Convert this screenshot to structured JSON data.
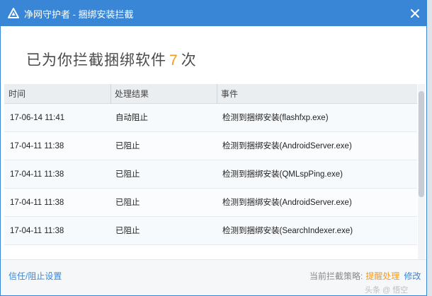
{
  "window": {
    "title": "净网守护者 - 捆绑安装拦截",
    "logo_icon": "triangle-shield-icon",
    "close_icon": "close-icon",
    "accent_color": "#3a86d6"
  },
  "heading": {
    "prefix": "已为你拦截捆绑软件",
    "count": "7",
    "suffix": "次",
    "count_color": "#f39a1e"
  },
  "table": {
    "columns": [
      "时间",
      "处理结果",
      "事件"
    ],
    "rows": [
      {
        "time": "17-06-14 11:41",
        "result": "自动阻止",
        "event": "检测到捆绑安装(flashfxp.exe)"
      },
      {
        "time": "17-04-11 11:38",
        "result": "已阻止",
        "event": "检测到捆绑安装(AndroidServer.exe)"
      },
      {
        "time": "17-04-11 11:38",
        "result": "已阻止",
        "event": "检测到捆绑安装(QMLspPing.exe)"
      },
      {
        "time": "17-04-11 11:38",
        "result": "已阻止",
        "event": "检测到捆绑安装(AndroidServer.exe)"
      },
      {
        "time": "17-04-11 11:38",
        "result": "已阻止",
        "event": "检测到捆绑安装(SearchIndexer.exe)"
      }
    ]
  },
  "footer": {
    "trust_link": "信任/阻止设置",
    "strategy_label": "当前拦截策略:",
    "strategy_value": "提醒处理",
    "edit_label": "修改",
    "watermark": "头条 @ 悟空"
  }
}
